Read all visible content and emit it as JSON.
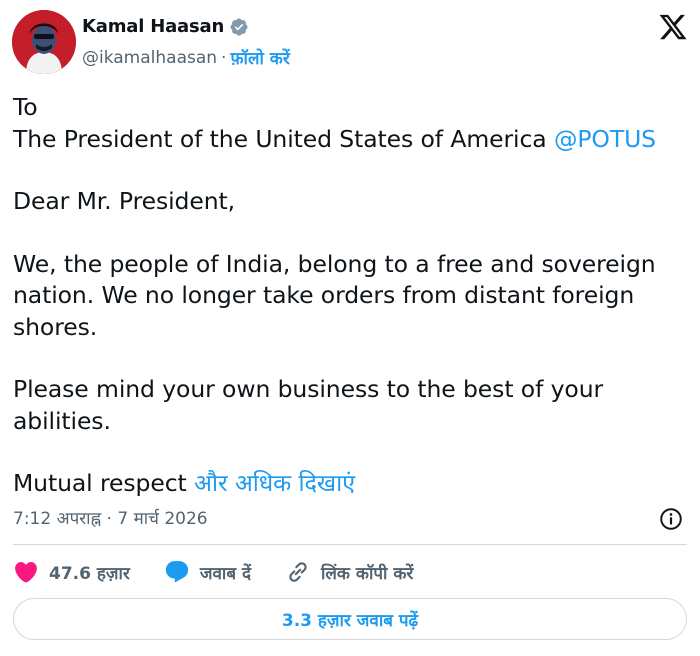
{
  "author": {
    "name": "Kamal Haasan",
    "handle": "@ikamalhaasan",
    "separator": "·",
    "follow_label": "फ़ॉलो करें"
  },
  "tweet": {
    "line_to": "To",
    "line_addressee": "The President of the United States of America ",
    "mention": "@POTUS",
    "salutation": "Dear Mr. President,",
    "para1": "We, the people of India, belong to a free and sovereign nation. We no longer take orders from distant foreign shores.",
    "para2": "Please mind your own business to the best of your abilities.",
    "closing": "Mutual respect ",
    "show_more": "और अधिक दिखाएं"
  },
  "meta": {
    "timestamp": "7:12 अपराह्न · 7 मार्च 2026"
  },
  "actions": {
    "likes": "47.6 हज़ार",
    "reply_label": "जवाब दें",
    "copy_link_label": "लिंक कॉपी करें"
  },
  "read_replies_label": "3.3 हज़ार जवाब पढ़ें",
  "icons": {
    "verified": "verified-badge-icon",
    "x_logo": "x-logo-icon",
    "info": "info-icon",
    "heart": "heart-icon",
    "reply": "chat-bubble-icon",
    "link": "link-icon"
  },
  "colors": {
    "accent": "#1d9bf0",
    "like": "#f91880",
    "text": "#0f1419",
    "muted": "#536471",
    "border": "#cfd9de"
  }
}
